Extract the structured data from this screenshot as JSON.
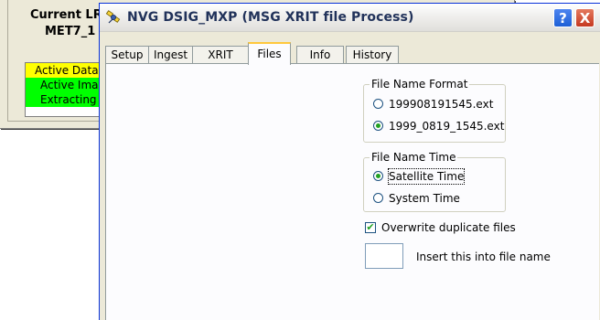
{
  "background_window": {
    "title_line1": "Current LRI",
    "title_line2": "MET7_1",
    "status_rows": [
      {
        "label": "Active Data I",
        "color": "#ffff00"
      },
      {
        "label": "Active Imag",
        "color": "#00ff00"
      },
      {
        "label": "Extracting In",
        "color": "#00ff00"
      }
    ]
  },
  "dialog": {
    "title": "NVG DSIG_MXP   (MSG XRIT file Process)",
    "icon": "satellite-icon",
    "help_label": "?",
    "close_label": "X",
    "tabs": [
      {
        "label": "Setup",
        "active": false
      },
      {
        "label": "Ingest",
        "active": false
      },
      {
        "label": "XRIT",
        "active": false
      },
      {
        "label": "Files",
        "active": true
      },
      {
        "label": "Info",
        "active": false
      },
      {
        "label": "History",
        "active": false
      }
    ],
    "file_name_format": {
      "legend": "File Name Format",
      "options": [
        {
          "label": "199908191545.ext",
          "checked": false
        },
        {
          "label": "1999_0819_1545.ext",
          "checked": true
        }
      ]
    },
    "file_name_time": {
      "legend": "File Name Time",
      "options": [
        {
          "label": "Satellite Time",
          "checked": true
        },
        {
          "label": "System Time",
          "checked": false
        }
      ]
    },
    "overwrite": {
      "label": "Overwrite duplicate files",
      "checked": true,
      "check_mark": "✔"
    },
    "insert_field": {
      "value": "",
      "label": "Insert this into file name"
    }
  }
}
